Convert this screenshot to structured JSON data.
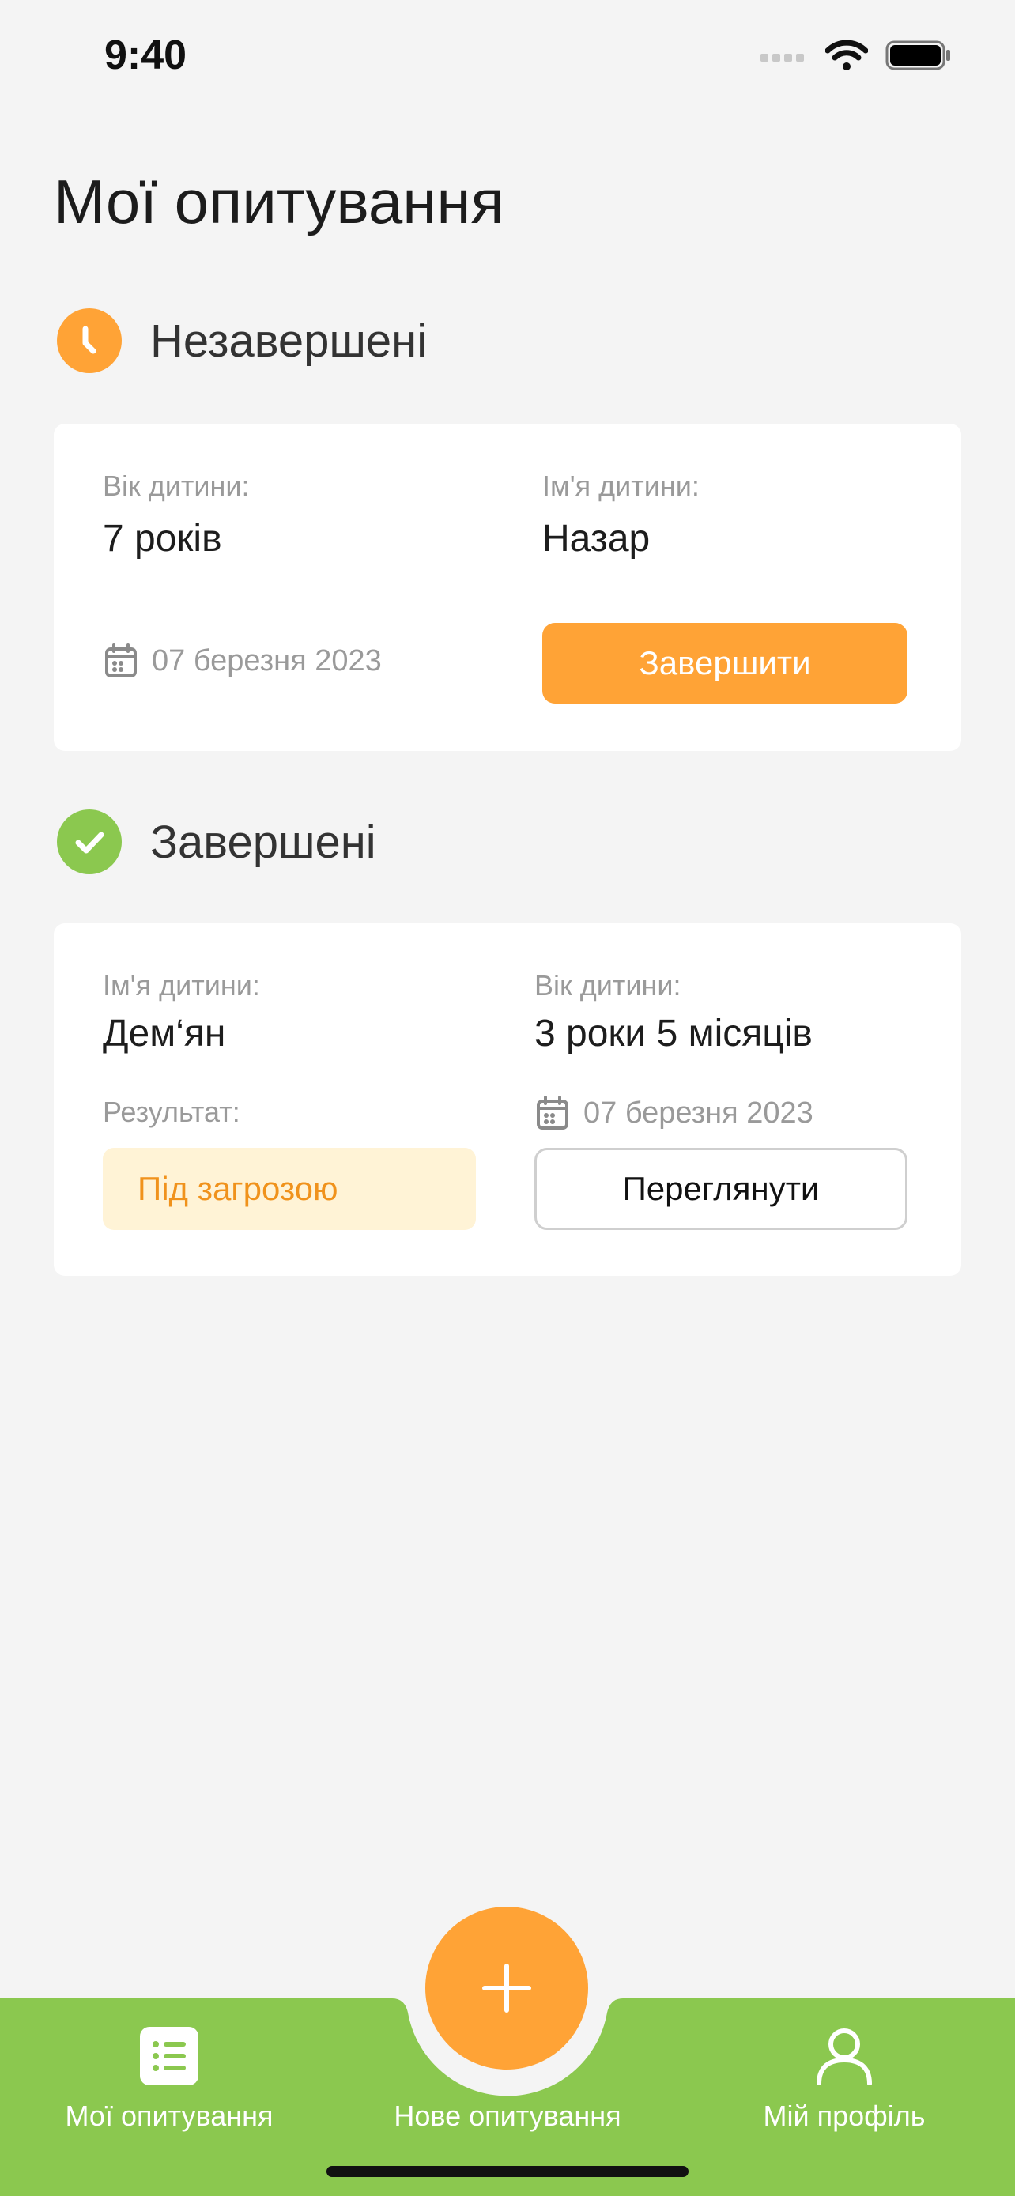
{
  "status_bar": {
    "time": "9:40"
  },
  "page_title": "Мої опитування",
  "sections": {
    "incomplete": {
      "title": "Незавершені",
      "card": {
        "age_label": "Вік дитини:",
        "age_value": "7 років",
        "name_label": "Ім'я дитини:",
        "name_value": "Назар",
        "date": "07 березня 2023",
        "action_label": "Завершити"
      }
    },
    "complete": {
      "title": "Завершені",
      "card": {
        "name_label": "Ім'я дитини:",
        "name_value": "Дем‘ян",
        "age_label": "Вік дитини:",
        "age_value": "3 роки 5 місяців",
        "result_label": "Результат:",
        "result_value": "Під загрозою",
        "date": "07 березня 2023",
        "action_label": "Переглянути"
      }
    }
  },
  "tab_bar": {
    "items": [
      {
        "label": "Мої опитування",
        "icon": "list-icon"
      },
      {
        "label": "Нове опитування",
        "icon": "plus-icon"
      },
      {
        "label": "Мій профіль",
        "icon": "user-icon"
      }
    ]
  },
  "colors": {
    "accent_orange": "#ffa336",
    "accent_green": "#8bc84f",
    "risk_bg": "#fff3d6",
    "risk_text": "#f0921c",
    "background": "#f4f4f4"
  }
}
